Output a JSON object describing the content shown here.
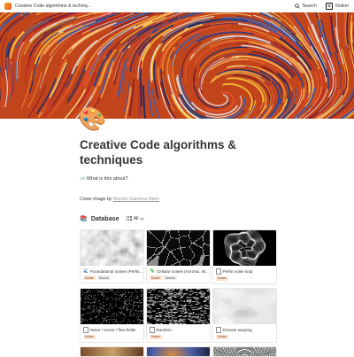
{
  "browser": {
    "tab_title": "Creative Code algorithms & techniq..."
  },
  "topbar": {
    "search_label": "Search",
    "notion_label": "Notion"
  },
  "page": {
    "icon": "🎨",
    "title": "Creative Code algorithms & techniques",
    "about_icon": "⌨️",
    "about_text": "What is this about?",
    "cover_credit_prefix": "Cover image by ",
    "cover_credit_author": "Manolo Gamboa Naon"
  },
  "database": {
    "icon": "📚",
    "title": "Database",
    "view_label": "All",
    "cards": [
      {
        "emoji": "🌊",
        "title": "Foundational noises (Perlin...",
        "tags": [
          {
            "label": "Noise",
            "color": "#fbe4d3",
            "text": "#7a3b12"
          },
          {
            "label": "Nature",
            "color": "#eeeeec",
            "text": "#5a5a57"
          }
        ]
      },
      {
        "emoji": "🦠",
        "title": "Cellular noises (Voronoi, W...",
        "tags": [
          {
            "label": "Noise",
            "color": "#fbe4d3",
            "text": "#7a3b12"
          },
          {
            "label": "Nature",
            "color": "#eeeeec",
            "text": "#5a5a57"
          }
        ]
      },
      {
        "emoji": "",
        "title": "Perlin noise loop",
        "tags": [
          {
            "label": "Noise",
            "color": "#fbe4d3",
            "text": "#7a3b12"
          }
        ]
      },
      {
        "emoji": "",
        "title": "Noise / vector / flow fields",
        "tags": [
          {
            "label": "Noise",
            "color": "#fbe4d3",
            "text": "#7a3b12"
          }
        ]
      },
      {
        "emoji": "",
        "title": "Random",
        "tags": [
          {
            "label": "Noise",
            "color": "#fbe4d3",
            "text": "#7a3b12"
          }
        ]
      },
      {
        "emoji": "",
        "title": "Domain warping",
        "tags": [
          {
            "label": "Noise",
            "color": "#fbe4d3",
            "text": "#7a3b12"
          }
        ]
      }
    ]
  }
}
